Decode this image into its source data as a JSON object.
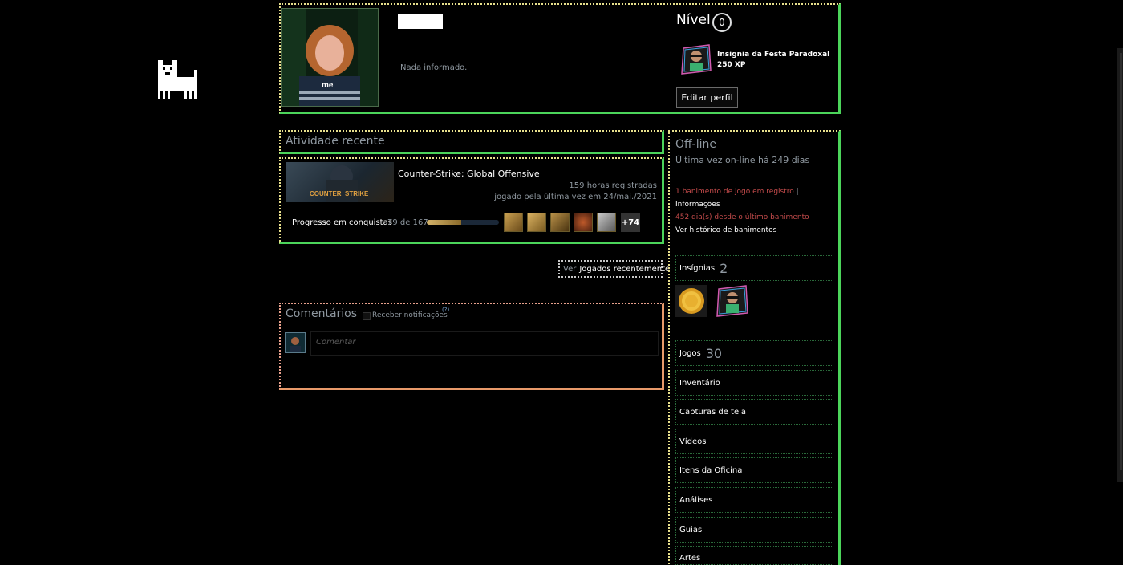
{
  "profile": {
    "summary": "Nada informado.",
    "level_label": "Nível",
    "level": "0",
    "favorite_badge": {
      "name": "Insígnia da Festa Paradoxal de ...",
      "xp": "250 XP"
    },
    "edit_button": "Editar perfil"
  },
  "recent_activity": {
    "title": "Atividade recente",
    "game": {
      "name": "Counter-Strike: Global Offensive",
      "cap_text_1": "COUNTER",
      "cap_text_2": "STRIKE",
      "hours": "159 horas registradas",
      "last_played": "jogado pela última vez em 24/mai./2021",
      "achievements_label": "Progresso em conquistas",
      "achievements_count": "79 de 167",
      "achievements_fraction": 0.473,
      "achievements_more": "+74"
    },
    "view_prefix": "Ver",
    "view_link": "Jogados recentemente"
  },
  "comments": {
    "title": "Comentários",
    "notify_label": "Receber notificações",
    "help": "(?)",
    "placeholder": "Comentar"
  },
  "sidebar": {
    "status": "Off-line",
    "last_online": "Última vez on-line há 249 dias",
    "ban_line1": "1 banimento de jogo em registro",
    "ban_sep": "|",
    "ban_info": "Informações",
    "ban_line2": "452 dia(s) desde o último banimento",
    "ban_history": "Ver histórico de banimentos",
    "badges": {
      "label": "Insígnias",
      "count": "2"
    },
    "games": {
      "label": "Jogos",
      "count": "30"
    },
    "links": [
      "Inventário",
      "Capturas de tela",
      "Vídeos",
      "Itens da Oficina",
      "Análises",
      "Guias",
      "Artes"
    ]
  },
  "colors": {
    "accent_green": "#4bd45a",
    "accent_yellow": "#e8e08c",
    "ban_red": "#c44b4b",
    "comment_border": "#e89a6a"
  }
}
